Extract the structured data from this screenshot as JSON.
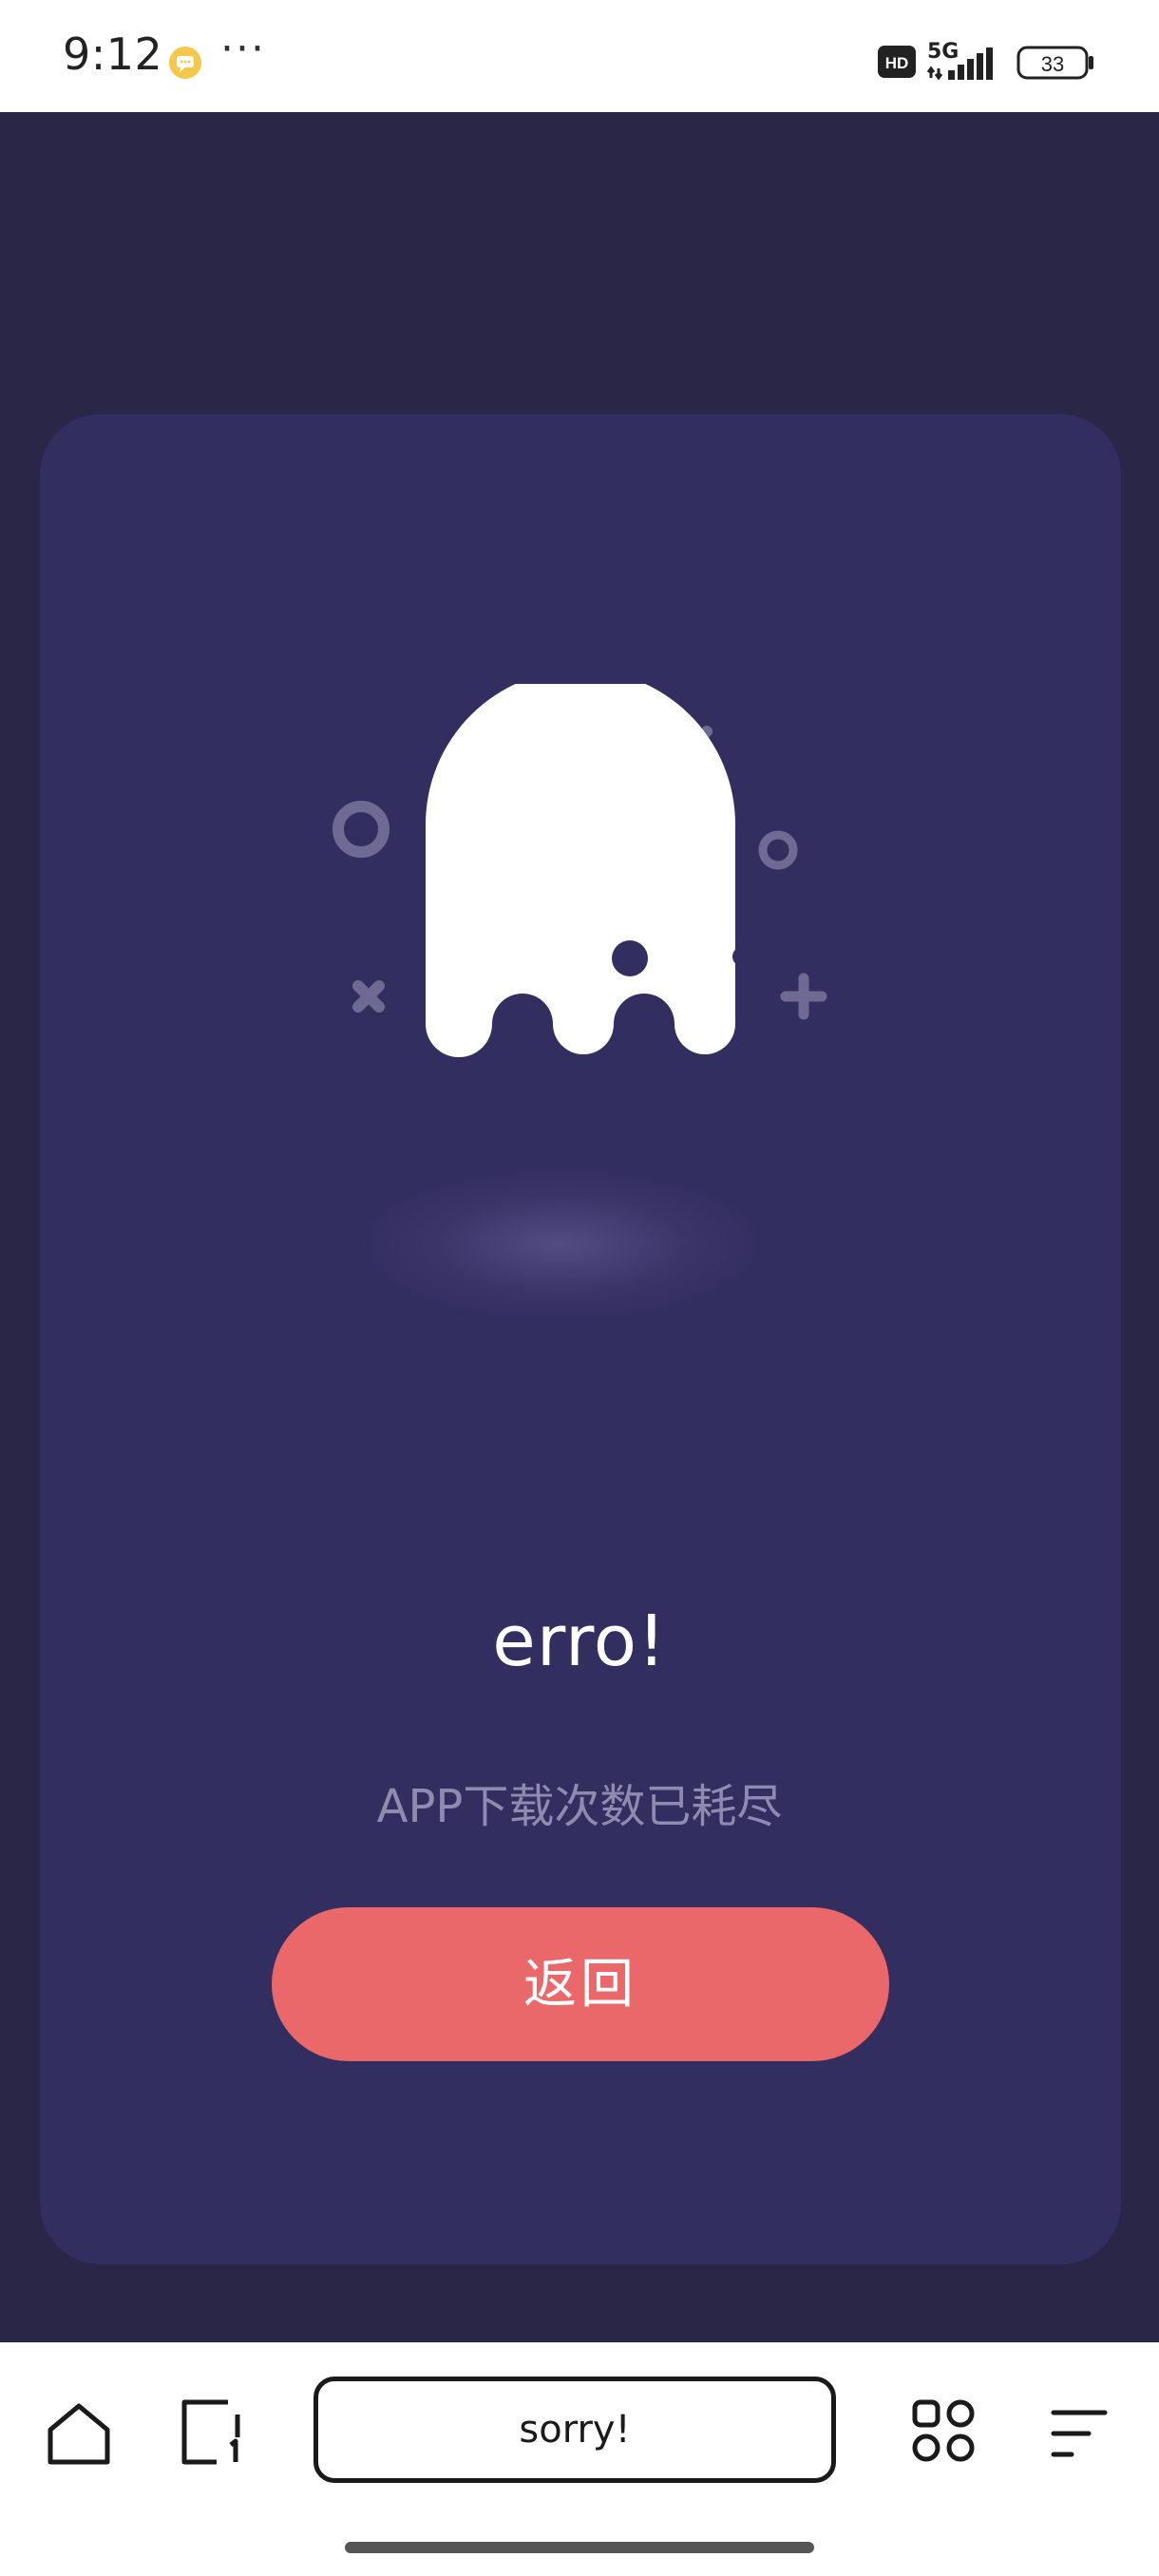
{
  "status_bar": {
    "time": "9:12",
    "more": "···",
    "hd": "HD",
    "network": "5G",
    "battery": "33"
  },
  "error_card": {
    "title": "erro!",
    "message": "APP下载次数已耗尽",
    "back_label": "返回"
  },
  "browser_toolbar": {
    "url_text": "sorry!"
  },
  "colors": {
    "page_bg": "#2a2647",
    "card_bg": "#332e60",
    "button": "#ea676a",
    "message_text": "#8f8ab0",
    "decor": "#6f6a93"
  },
  "icons": [
    "notification-icon",
    "hd-icon",
    "signal-icon",
    "battery-icon",
    "ghost-illustration",
    "home-icon",
    "tabs-icon",
    "apps-grid-icon",
    "menu-icon"
  ]
}
